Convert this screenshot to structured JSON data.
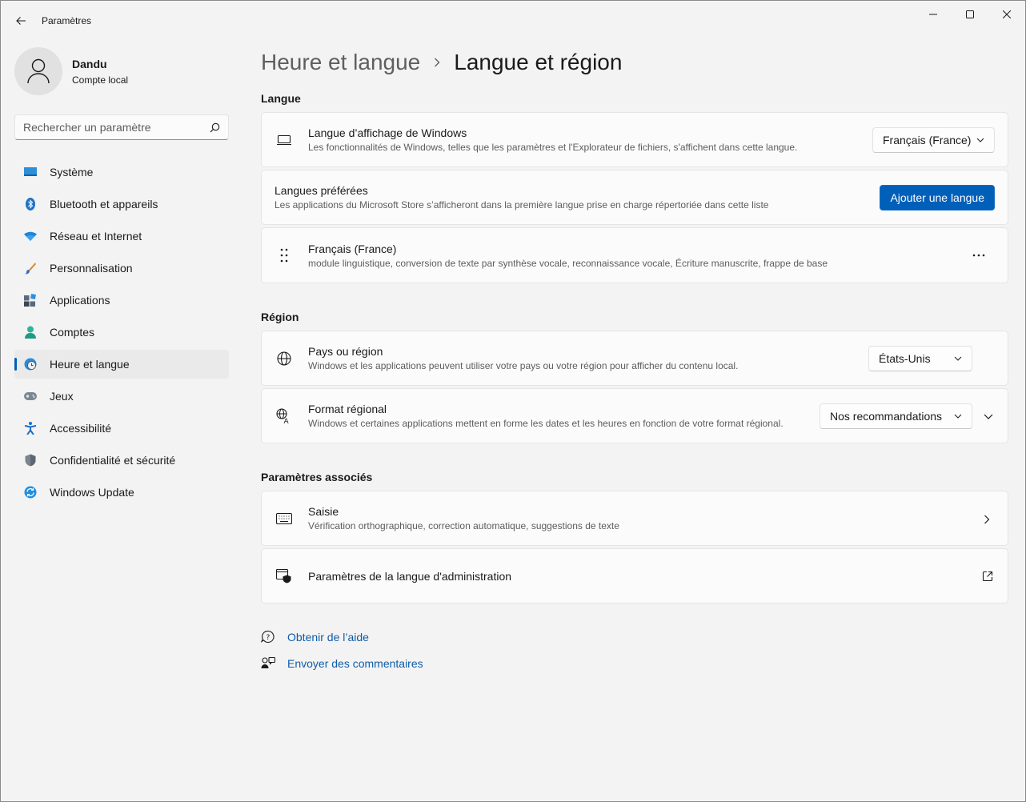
{
  "window": {
    "title": "Paramètres"
  },
  "profile": {
    "name": "Dandu",
    "account_type": "Compte local"
  },
  "search": {
    "placeholder": "Rechercher un paramètre"
  },
  "sidebar": {
    "items": [
      {
        "label": "Système",
        "icon": "system-icon",
        "active": false
      },
      {
        "label": "Bluetooth et appareils",
        "icon": "bluetooth-icon",
        "active": false
      },
      {
        "label": "Réseau et Internet",
        "icon": "wifi-icon",
        "active": false
      },
      {
        "label": "Personnalisation",
        "icon": "brush-icon",
        "active": false
      },
      {
        "label": "Applications",
        "icon": "apps-icon",
        "active": false
      },
      {
        "label": "Comptes",
        "icon": "account-icon",
        "active": false
      },
      {
        "label": "Heure et langue",
        "icon": "time-language-icon",
        "active": true
      },
      {
        "label": "Jeux",
        "icon": "gamepad-icon",
        "active": false
      },
      {
        "label": "Accessibilité",
        "icon": "accessibility-icon",
        "active": false
      },
      {
        "label": "Confidentialité et sécurité",
        "icon": "shield-icon",
        "active": false
      },
      {
        "label": "Windows Update",
        "icon": "update-icon",
        "active": false
      }
    ]
  },
  "breadcrumb": {
    "parent": "Heure et langue",
    "current": "Langue et région"
  },
  "sections": {
    "language": {
      "title": "Langue",
      "display_language": {
        "title": "Langue d’affichage de Windows",
        "description": "Les fonctionnalités de Windows, telles que les paramètres et l'Explorateur de fichiers, s'affichent dans cette langue.",
        "value": "Français (France)"
      },
      "preferred": {
        "title": "Langues préférées",
        "description": "Les applications du Microsoft Store s’afficheront dans la première langue prise en charge répertoriée dans cette liste",
        "button": "Ajouter une langue"
      },
      "installed": {
        "title": "Français (France)",
        "description": "module linguistique, conversion de texte par synthèse vocale, reconnaissance vocale, Écriture manuscrite, frappe de base"
      }
    },
    "region": {
      "title": "Région",
      "country": {
        "title": "Pays ou région",
        "description": "Windows et les applications peuvent utiliser votre pays ou votre région pour afficher du contenu local.",
        "value": "États-Unis"
      },
      "format": {
        "title": "Format régional",
        "description": "Windows et certaines applications mettent en forme les dates et les heures en fonction de votre format régional.",
        "value": "Nos recommandations"
      }
    },
    "related": {
      "title": "Paramètres associés",
      "typing": {
        "title": "Saisie",
        "description": "Vérification orthographique, correction automatique, suggestions de texte"
      },
      "admin": {
        "title": "Paramètres de la langue d'administration"
      }
    }
  },
  "help": {
    "get_help": "Obtenir de l’aide",
    "feedback": "Envoyer des commentaires"
  },
  "colors": {
    "accent": "#005fb8",
    "background": "#f3f3f3",
    "card": "#fbfbfb"
  }
}
